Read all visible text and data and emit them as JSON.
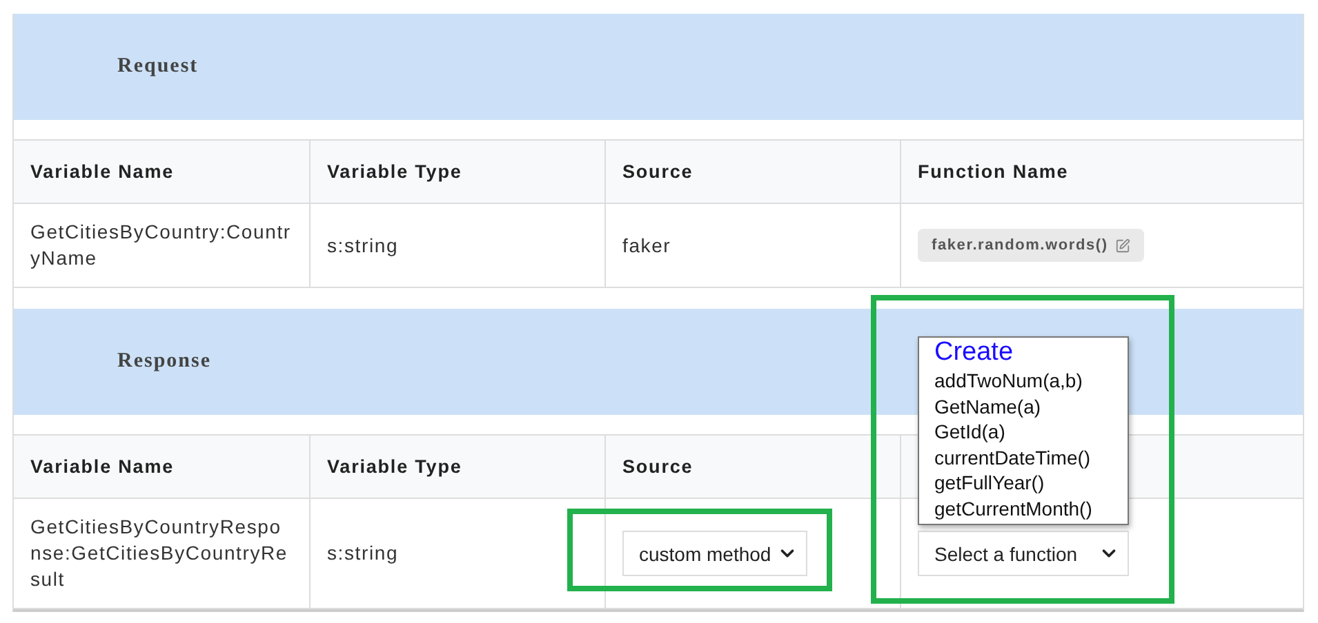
{
  "sections": [
    {
      "title": "Request",
      "columns": [
        "Variable Name",
        "Variable Type",
        "Source",
        "Function Name"
      ],
      "rows": [
        {
          "variable_name": "GetCitiesByCountry:CountryName",
          "variable_type": "s:string",
          "source": {
            "kind": "text",
            "value": "faker"
          },
          "function": {
            "kind": "badge",
            "value": "faker.random.words()"
          }
        }
      ]
    },
    {
      "title": "Response",
      "columns": [
        "Variable Name",
        "Variable Type",
        "Source"
      ],
      "rows": [
        {
          "variable_name": "GetCitiesByCountryResponse:GetCitiesByCountryResult",
          "variable_type": "s:string",
          "source": {
            "kind": "select",
            "value": "custom method"
          },
          "function": {
            "kind": "select",
            "value": "Select a function",
            "expanded": true,
            "options": [
              {
                "label": "Create",
                "kind": "link"
              },
              {
                "label": "addTwoNum(a,b)",
                "kind": "option"
              },
              {
                "label": "GetName(a)",
                "kind": "option"
              },
              {
                "label": "GetId(a)",
                "kind": "option"
              },
              {
                "label": "currentDateTime()",
                "kind": "option"
              },
              {
                "label": "getFullYear()",
                "kind": "option"
              },
              {
                "label": "getCurrentMonth()",
                "kind": "option"
              }
            ]
          }
        }
      ]
    }
  ]
}
